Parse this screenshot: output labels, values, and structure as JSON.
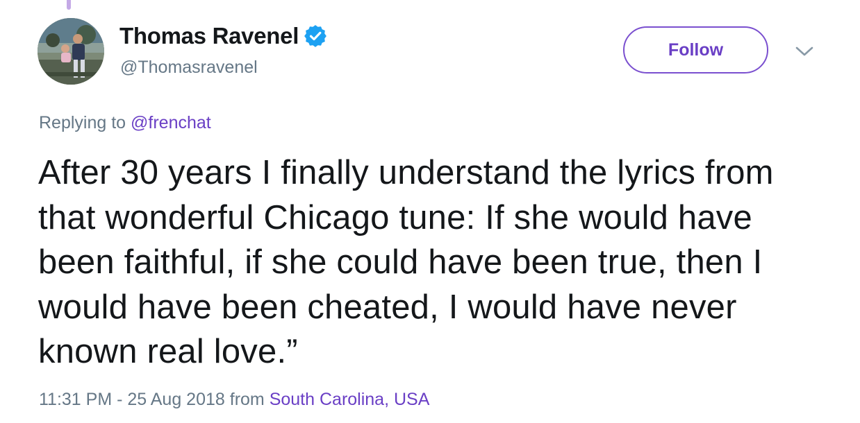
{
  "tweet": {
    "author": {
      "display_name": "Thomas Ravenel",
      "handle": "@Thomasravenel",
      "verified": true,
      "avatar_icon": "profile-photo"
    },
    "follow_label": "Follow",
    "more_icon": "chevron-down-icon",
    "reply": {
      "prefix": "Replying to",
      "mention": "@frenchat"
    },
    "text": "After 30 years I finally understand the lyrics from that wonderful Chicago tune: If she would have been faithful, if she could have been true, then I would have been cheated, I would have never known real love.”",
    "timestamp": "11:31 PM - 25 Aug 2018",
    "from_label": "from",
    "location": "South Carolina, USA"
  },
  "colors": {
    "accent": "#6a3fc5",
    "verified_badge": "#1da1f2",
    "secondary_text": "#657786",
    "primary_text": "#14171a"
  }
}
